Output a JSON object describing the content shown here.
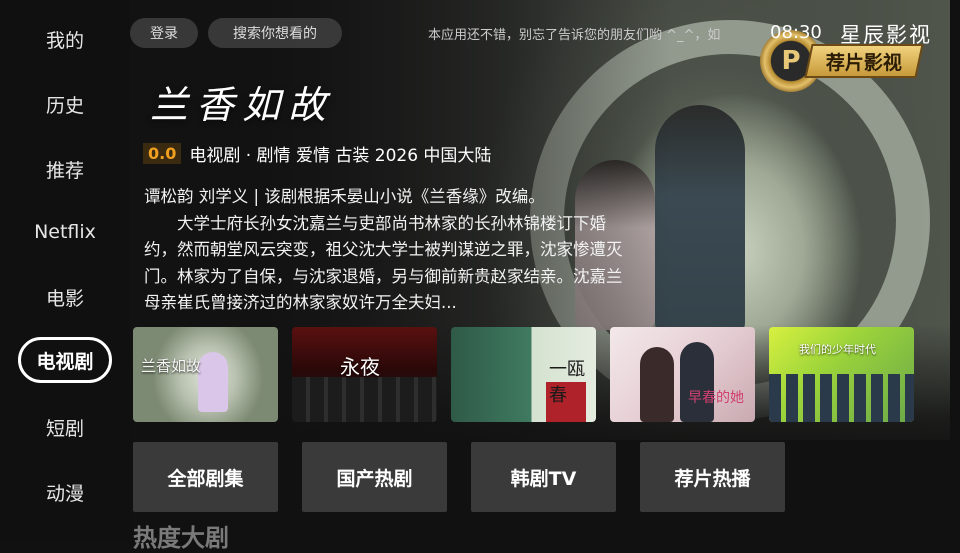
{
  "sidebar": {
    "items": [
      {
        "label": "我的"
      },
      {
        "label": "历史"
      },
      {
        "label": "推荐"
      },
      {
        "label": "Netflix"
      },
      {
        "label": "电影"
      },
      {
        "label": "电视剧",
        "active": true
      },
      {
        "label": "短剧"
      },
      {
        "label": "动漫"
      }
    ]
  },
  "topbar": {
    "login_label": "登录",
    "search_label": "搜索你想看的",
    "marquee": "本应用还不错，别忘了告诉您的朋友们哟 ^_^，如",
    "clock": "08:30",
    "app_name": "星辰影视"
  },
  "logo": {
    "letter": "P",
    "text": "荐片影视"
  },
  "featured": {
    "title": "兰香如故",
    "score": "0.0",
    "meta": "电视剧 · 剧情 爱情 古装  2026  中国大陆",
    "cast_line": "谭松韵 刘学义 | 该剧根据禾晏山小说《兰香缘》改编。",
    "synopsis": "大学士府长孙女沈嘉兰与吏部尚书林家的长孙林锦楼订下婚约，然而朝堂风云突变，祖父沈大学士被判谋逆之罪，沈家惨遭灭门。林家为了自保，与沈家退婚，另与御前新贵赵家结亲。沈嘉兰母亲崔氏曾接济过的林家家奴许万全夫妇..."
  },
  "thumbnails": [
    {
      "title": "兰香如故"
    },
    {
      "title": "永夜"
    },
    {
      "title": "一瓯春"
    },
    {
      "title": "早春的她"
    },
    {
      "title": "我们的少年时代"
    }
  ],
  "categories": [
    {
      "label": "全部剧集"
    },
    {
      "label": "国产热剧"
    },
    {
      "label": "韩剧TV"
    },
    {
      "label": "荐片热播"
    }
  ],
  "section_title": "热度大剧",
  "colors": {
    "accent_score": "#f0a020",
    "active_border": "#ffffff",
    "button_bg": "#3a3a3a"
  }
}
